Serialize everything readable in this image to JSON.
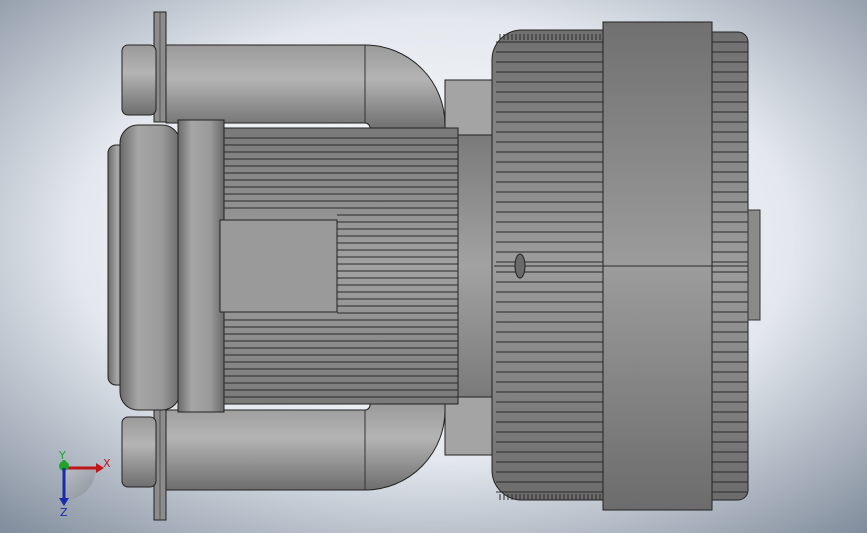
{
  "viewport": {
    "background_center": "#ffffff",
    "background_edge": "#8a96a6"
  },
  "model": {
    "body_color": "#8c8c8c",
    "highlight_color": "#b8b8b8",
    "shadow_color": "#5a5a5a",
    "edge_color": "#222222"
  },
  "triad": {
    "x_label": "X",
    "y_label": "Y",
    "z_label": "Z",
    "x_color": "#c0151b",
    "y_color": "#1fa32a",
    "z_color": "#1b2ba8"
  }
}
